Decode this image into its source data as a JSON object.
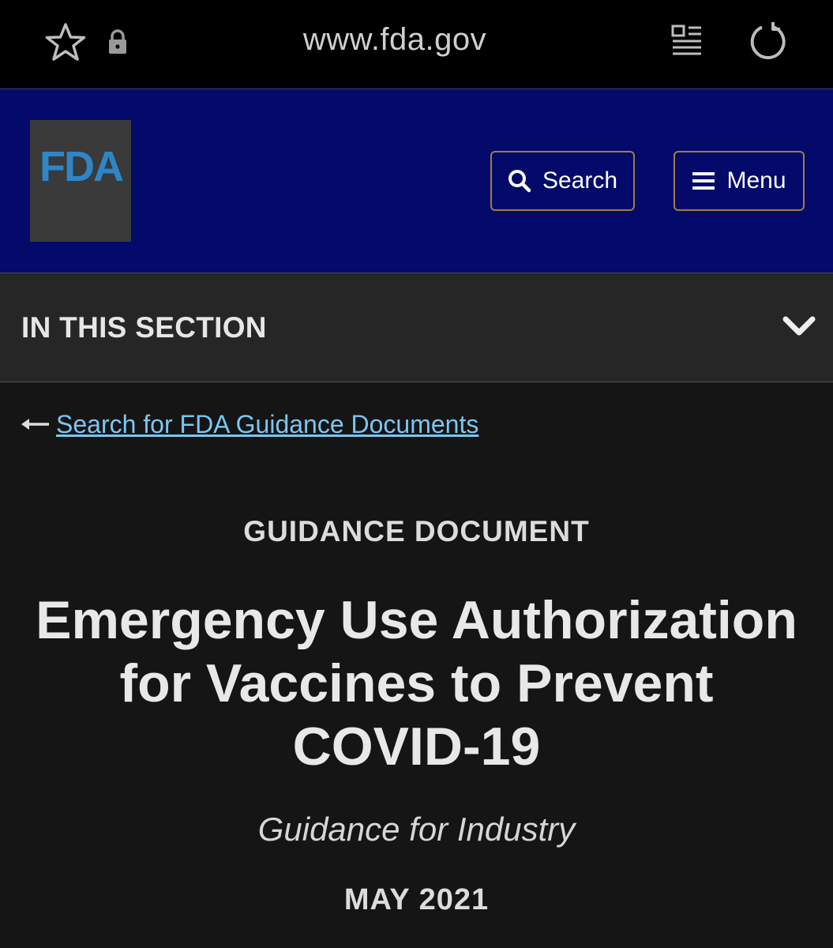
{
  "browser": {
    "url": "www.fda.gov",
    "icons": [
      "star-icon",
      "lock-icon",
      "reader-mode-icon",
      "reload-icon"
    ]
  },
  "header": {
    "logo_text": "FDA",
    "search_label": "Search",
    "menu_label": "Menu",
    "colors": {
      "background": "#030a6a",
      "logo_box": "#3a3a3a",
      "logo_text": "#2e86c8",
      "button_border": "#a37a4a"
    }
  },
  "section_nav": {
    "title": "IN THIS SECTION",
    "icon": "chevron-down-icon"
  },
  "main": {
    "back_link": "Search for FDA Guidance Documents",
    "doc_kind": "GUIDANCE DOCUMENT",
    "title": "Emergency Use Authorization for Vaccines to Prevent COVID-19",
    "subtitle": "Guidance for Industry",
    "date": "MAY 2021",
    "link_color": "#7cc6f0"
  }
}
